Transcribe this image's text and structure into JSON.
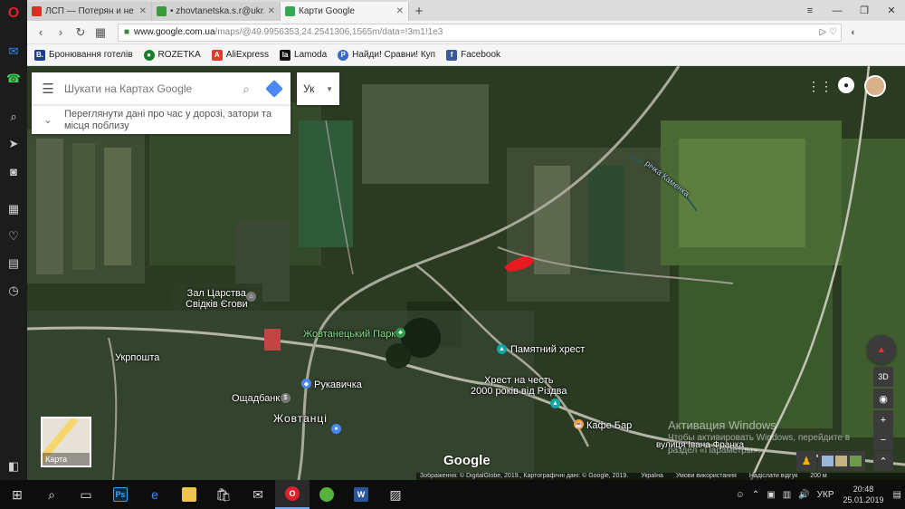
{
  "tabs": [
    {
      "title": "ЛСП — Потерян и не най",
      "color": "#d93025"
    },
    {
      "title": "• zhovtanetska.s.r@ukr.net",
      "color": "#3a9b3a"
    },
    {
      "title": "Карти Google",
      "color": "#34a853"
    }
  ],
  "window": {
    "minimize": "—",
    "restore": "❐",
    "close": "✕",
    "more": "≡"
  },
  "address": {
    "domain": "www.google.com.ua",
    "path": "/maps/@49.9956353,24.2541306,1565m/data=!3m1!1e3"
  },
  "bookmarks": [
    {
      "label": "Бронювання готелів",
      "icon": "B.",
      "color": "#1c3e8f"
    },
    {
      "label": "ROZETKA",
      "icon": "●",
      "color": "#1a7f2b"
    },
    {
      "label": "AliExpress",
      "icon": "A",
      "color": "#e53b2c"
    },
    {
      "label": "Lamoda",
      "icon": "la",
      "color": "#111111"
    },
    {
      "label": "Найди! Сравни! Куп",
      "icon": "P",
      "color": "#3a6bc4"
    },
    {
      "label": "Facebook",
      "icon": "f",
      "color": "#3b5998"
    }
  ],
  "search": {
    "placeholder": "Шукати на Картах Google"
  },
  "traffic_text": "Переглянути дані про час у дорозі, затори та місця поблизу",
  "lang": "Ук",
  "labels": {
    "kingdom_hall_1": "Зал Царства",
    "kingdom_hall_2": "Свідків Єгови",
    "park": "Жовтанецький Парк",
    "memorial_cross": "Памятний хрест",
    "cross_1": "Хрест на честь",
    "cross_2": "2000 років від Різдва",
    "post": "Укрпошта",
    "store": "Рукавичка",
    "bank": "Ощадбанк",
    "village": "Жовтанці",
    "cafe": "Кафе Бар",
    "street": "вулиця Івана Франка",
    "river": "річка Каменка"
  },
  "layer_label": "Карта",
  "controls": {
    "tilt": "3D",
    "zoom_in": "+",
    "zoom_out": "−",
    "compass_n": "▲",
    "expand": "⌃"
  },
  "watermark": {
    "line1": "Активация Windows",
    "line2": "Чтобы активировать Windows, перейдите в",
    "line3": "раздел «Параметры»."
  },
  "google_logo": "Google",
  "attribution": [
    "Зображення: © DigitalGlobe, 2019., Картографічні дані: © Google, 2019.",
    "Україна",
    "Умови використання",
    "Надіслати відгук",
    "200 м"
  ],
  "taskbar": {
    "lang": "УКР",
    "time": "20:48",
    "date": "25.01.2019"
  },
  "colors": {
    "map_base": "#2b3b22",
    "highlight": "#e8191f",
    "accent": "#4a89f3"
  }
}
